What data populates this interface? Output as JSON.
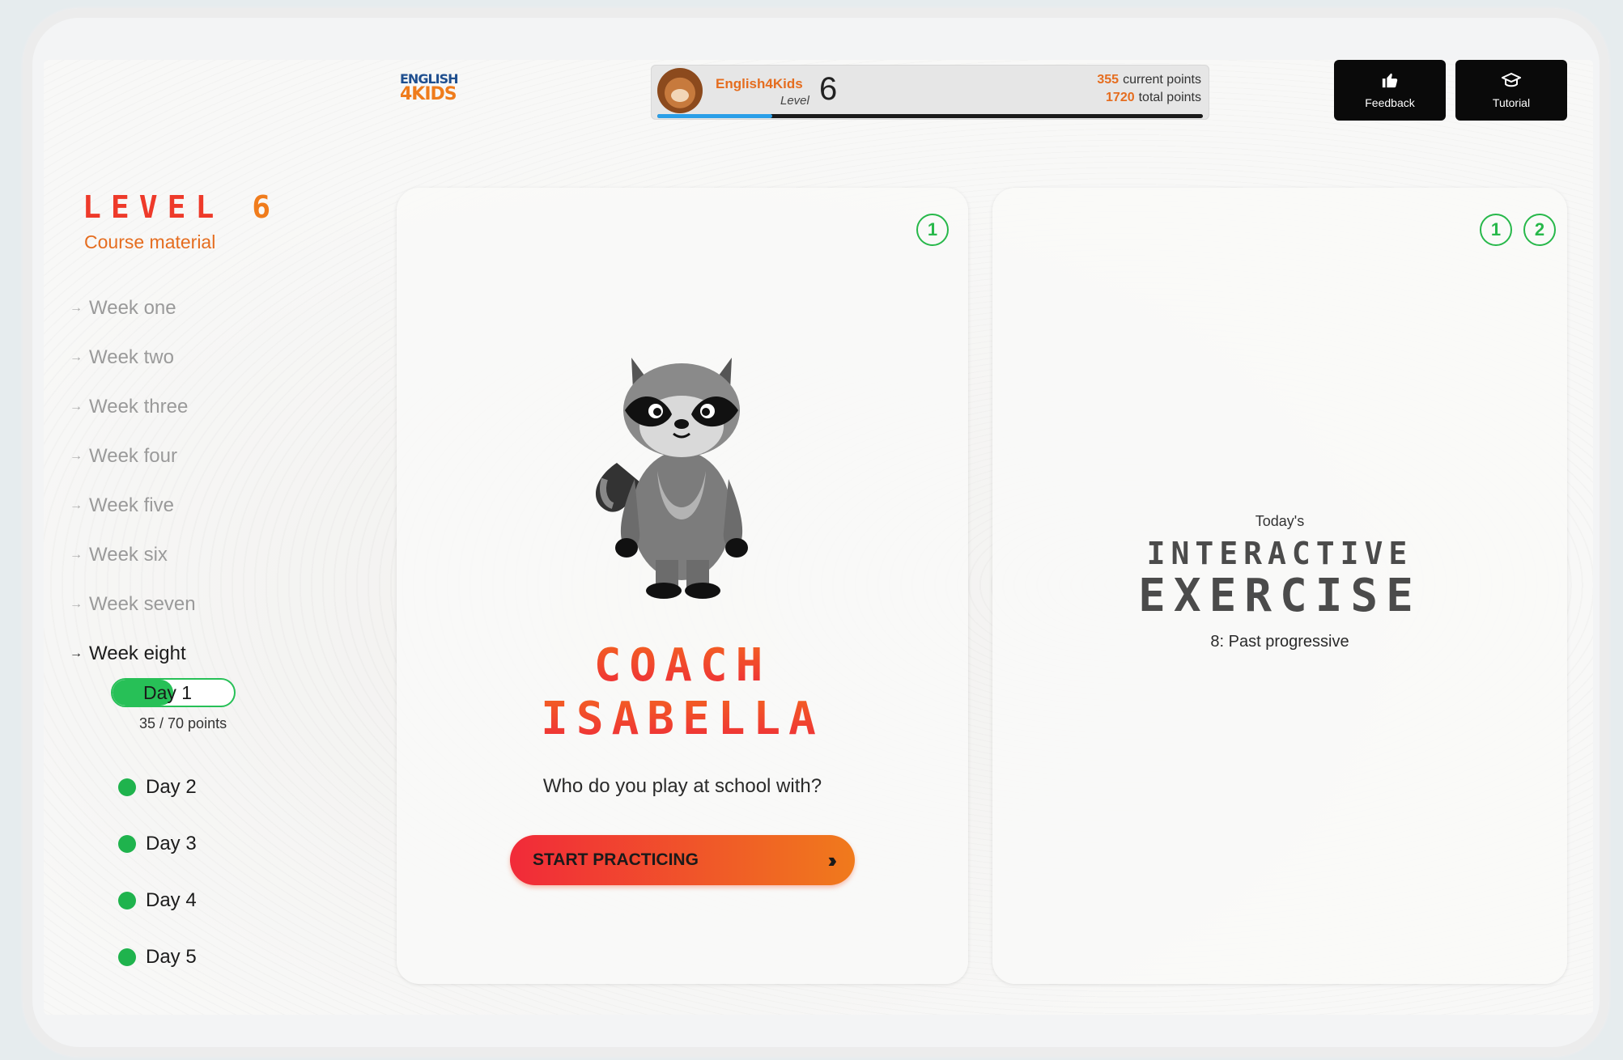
{
  "header": {
    "logo": {
      "line1": "ENGLISH",
      "line2": "4KIDS"
    },
    "progress": {
      "brand": "English4Kids",
      "level_word": "Level",
      "level_number": "6",
      "current_points_value": "355",
      "current_points_label": "current points",
      "total_points_value": "1720",
      "total_points_label": "total points",
      "progress_fraction": 0.21
    },
    "buttons": {
      "feedback": {
        "label": "Feedback",
        "icon": "thumbs-up-icon"
      },
      "tutorial": {
        "label": "Tutorial",
        "icon": "graduation-cap-icon"
      }
    }
  },
  "sidebar": {
    "level_word": "LEVEL",
    "level_number": "6",
    "section_label": "Course material",
    "weeks": [
      {
        "label": "Week one",
        "active": false
      },
      {
        "label": "Week two",
        "active": false
      },
      {
        "label": "Week three",
        "active": false
      },
      {
        "label": "Week four",
        "active": false
      },
      {
        "label": "Week five",
        "active": false
      },
      {
        "label": "Week six",
        "active": false
      },
      {
        "label": "Week seven",
        "active": false
      },
      {
        "label": "Week eight",
        "active": true
      }
    ],
    "current_day": {
      "label": "Day 1",
      "points_text": "35 / 70 points",
      "progress_fraction": 0.5
    },
    "days": [
      {
        "label": "Day 2"
      },
      {
        "label": "Day 3"
      },
      {
        "label": "Day 4"
      },
      {
        "label": "Day 5"
      }
    ]
  },
  "coach_card": {
    "badge": "1",
    "title_line1": "COACH",
    "title_line2": "ISABELLA",
    "question": "Who do you play at school with?",
    "button_label": "START PRACTICING",
    "button_icon": "double-chevron-right-icon"
  },
  "exercise_card": {
    "badges": [
      "1",
      "2"
    ],
    "prefix": "Today's",
    "title_line1": "INTERACTIVE",
    "title_line2": "EXERCISE",
    "subtitle": "8: Past progressive"
  },
  "colors": {
    "accent_orange": "#f07c1c",
    "accent_red": "#ee2a3a",
    "success_green": "#27c057",
    "dark_button": "#0a0a0a"
  }
}
